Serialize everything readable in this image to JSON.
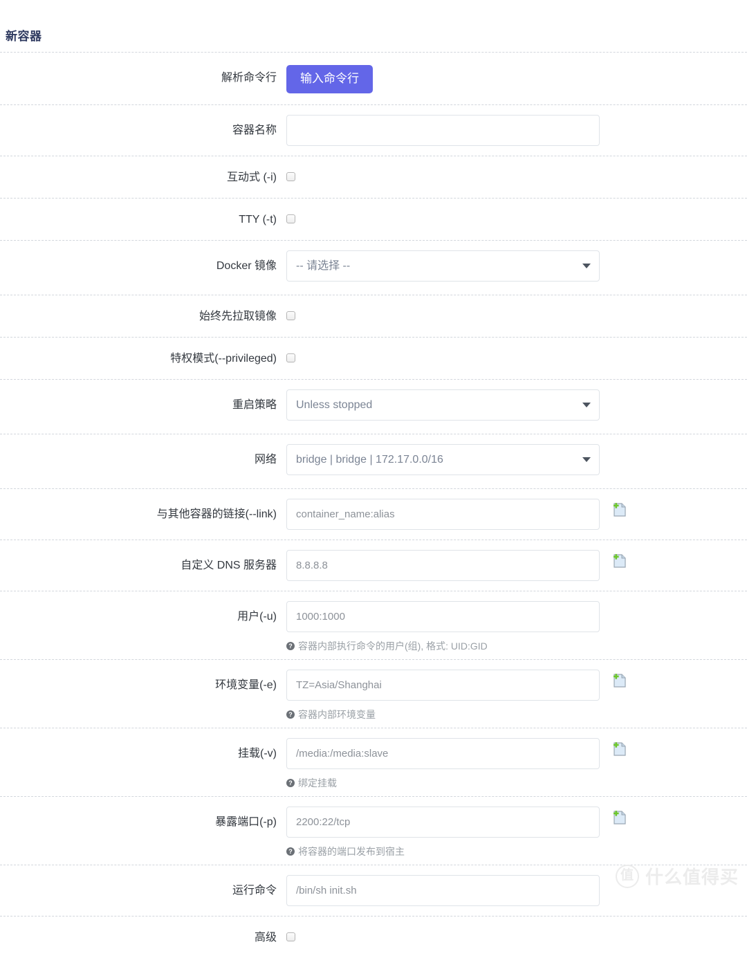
{
  "page": {
    "title": "新容器"
  },
  "rows": {
    "parse_cmdline": {
      "label": "解析命令行",
      "button_label": "输入命令行"
    },
    "container_name": {
      "label": "容器名称",
      "value": "",
      "placeholder": ""
    },
    "interactive": {
      "label": "互动式 (-i)",
      "checked": false
    },
    "tty": {
      "label": "TTY (-t)",
      "checked": false
    },
    "docker_image": {
      "label": "Docker 镜像",
      "selected": "-- 请选择 --"
    },
    "always_pull": {
      "label": "始终先拉取镜像",
      "checked": false
    },
    "privileged": {
      "label": "特权模式(--privileged)",
      "checked": false
    },
    "restart_policy": {
      "label": "重启策略",
      "selected": "Unless stopped"
    },
    "network": {
      "label": "网络",
      "selected": "bridge | bridge | 172.17.0.0/16"
    },
    "link": {
      "label": "与其他容器的链接(--link)",
      "placeholder": "container_name:alias",
      "add_icon": "add-document-icon"
    },
    "dns": {
      "label": "自定义 DNS 服务器",
      "placeholder": "8.8.8.8",
      "add_icon": "add-document-icon"
    },
    "user": {
      "label": "用户(-u)",
      "placeholder": "1000:1000",
      "help": "容器内部执行命令的用户(组), 格式: UID:GID"
    },
    "env": {
      "label": "环境变量(-e)",
      "placeholder": "TZ=Asia/Shanghai",
      "help": "容器内部环境变量",
      "add_icon": "add-document-icon"
    },
    "volume": {
      "label": "挂载(-v)",
      "placeholder": "/media:/media:slave",
      "help": "绑定挂载",
      "add_icon": "add-document-icon"
    },
    "ports": {
      "label": "暴露端口(-p)",
      "placeholder": "2200:22/tcp",
      "help": "将容器的端口发布到宿主",
      "add_icon": "add-document-icon"
    },
    "run_command": {
      "label": "运行命令",
      "placeholder": "/bin/sh init.sh"
    },
    "advanced": {
      "label": "高级",
      "checked": false
    }
  },
  "watermark": {
    "badge": "值",
    "text": "什么值得买"
  },
  "colors": {
    "accent": "#6366e8",
    "title": "#2f3a60",
    "divider": "#d2d6dc",
    "placeholder": "#8d9299",
    "select_text": "#7b8494",
    "help_text": "#9aa0a6",
    "icon_plus": "#6ec72d",
    "icon_page": "#cfe4f5"
  }
}
